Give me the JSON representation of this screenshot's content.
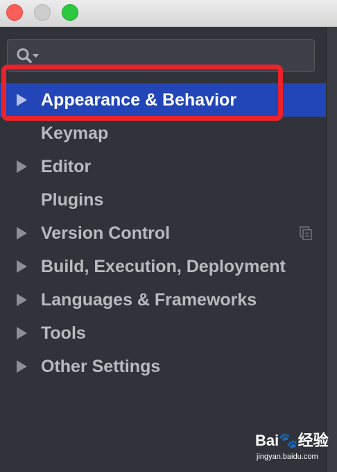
{
  "window": {
    "controls": [
      "close",
      "minimize",
      "zoom"
    ]
  },
  "search": {
    "placeholder": "",
    "value": ""
  },
  "tree": {
    "items": [
      {
        "label": "Appearance & Behavior",
        "expandable": true,
        "selected": true
      },
      {
        "label": "Keymap",
        "expandable": false,
        "selected": false
      },
      {
        "label": "Editor",
        "expandable": true,
        "selected": false
      },
      {
        "label": "Plugins",
        "expandable": false,
        "selected": false
      },
      {
        "label": "Version Control",
        "expandable": true,
        "selected": false,
        "trailing_icon": "copy-project-icon"
      },
      {
        "label": "Build, Execution, Deployment",
        "expandable": true,
        "selected": false
      },
      {
        "label": "Languages & Frameworks",
        "expandable": true,
        "selected": false
      },
      {
        "label": "Tools",
        "expandable": true,
        "selected": false
      },
      {
        "label": "Other Settings",
        "expandable": true,
        "selected": false
      }
    ]
  },
  "annotation": {
    "color": "#e8232c",
    "target": "Appearance & Behavior"
  },
  "watermark": {
    "logo": "Bai🐾经验",
    "url": "jingyan.baidu.com"
  },
  "colors": {
    "background": "#30333a",
    "selection": "#2245b8",
    "text": "#b8babe",
    "selected_text": "#ffffff"
  }
}
